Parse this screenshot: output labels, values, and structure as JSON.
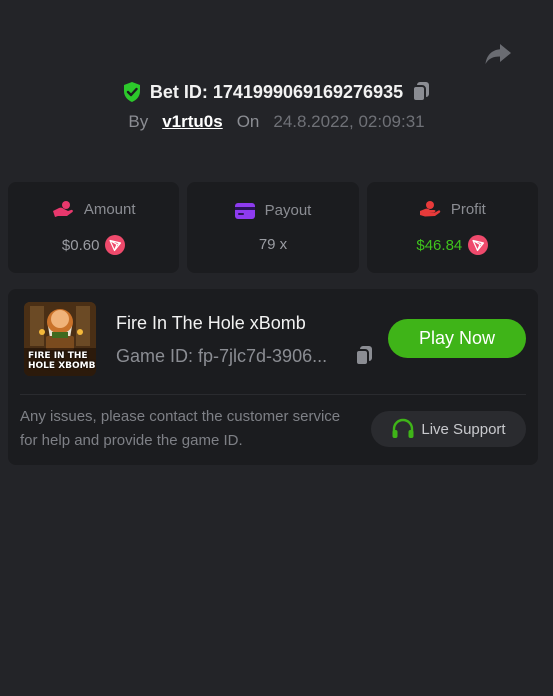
{
  "header": {
    "bet_id_label": "Bet ID: 1741999069169276935",
    "by_label": "By",
    "username": "v1rtu0s",
    "on_label": "On",
    "datetime": "24.8.2022, 02:09:31"
  },
  "stats": {
    "amount": {
      "title": "Amount",
      "value": "$0.60"
    },
    "payout": {
      "title": "Payout",
      "value": "79 x"
    },
    "profit": {
      "title": "Profit",
      "value": "$46.84"
    }
  },
  "game": {
    "thumbnail_line1": "FIRE IN THE",
    "thumbnail_line2": "HOLE XBOMB",
    "name": "Fire In The Hole xBomb",
    "game_id": "Game ID: fp-7jlc7d-3906...",
    "play_label": "Play Now",
    "notice": "Any issues, please contact the customer service for help and provide the game ID.",
    "support_label": "Live Support"
  },
  "icons": {
    "share": "share-icon",
    "verified": "shield-check-icon",
    "copy": "copy-icon",
    "amount": "coin-hand-icon",
    "payout": "wallet-icon",
    "profit": "money-hand-icon",
    "currency": "tron-icon",
    "support": "headset-icon"
  },
  "colors": {
    "background": "#232428",
    "card": "#1b1c1f",
    "accent_green": "#3fb418",
    "profit_green": "#3fc31d",
    "verified_green": "#2cc92b",
    "amount_pink": "#e8386d",
    "payout_purple": "#8e3bf0",
    "profit_red": "#e83a3a"
  }
}
